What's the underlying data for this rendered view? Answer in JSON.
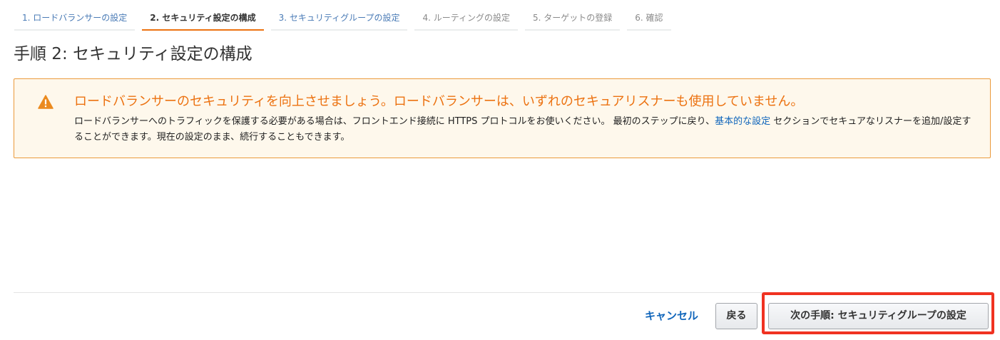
{
  "wizard": {
    "steps": [
      {
        "label": "1. ロードバランサーの設定",
        "state": "done"
      },
      {
        "label": "2. セキュリティ設定の構成",
        "state": "active"
      },
      {
        "label": "3. セキュリティグループの設定",
        "state": "done"
      },
      {
        "label": "4. ルーティングの設定",
        "state": "pending"
      },
      {
        "label": "5. ターゲットの登録",
        "state": "pending"
      },
      {
        "label": "6. 確認",
        "state": "pending"
      }
    ]
  },
  "page": {
    "title": "手順 2: セキュリティ設定の構成"
  },
  "alert": {
    "icon": "warning-icon",
    "title": "ロードバランサーのセキュリティを向上させましょう。ロードバランサーは、いずれのセキュアリスナーも使用していません。",
    "body_before_link": "ロードバランサーへのトラフィックを保護する必要がある場合は、フロントエンド接続に HTTPS プロトコルをお使いください。 最初のステップに戻り、",
    "link_text": "基本的な設定",
    "body_after_link": " セクションでセキュアなリスナーを追加/設定することができます。現在の設定のまま、続行することもできます。",
    "colors": {
      "border": "#eb9a3b",
      "background": "#fef8ec",
      "title": "#ec7211"
    }
  },
  "footer": {
    "cancel_label": "キャンセル",
    "back_label": "戻る",
    "next_label": "次の手順: セキュリティグループの設定"
  },
  "colors": {
    "accent": "#ec7211",
    "link": "#1166bb",
    "highlight": "#f03221"
  }
}
